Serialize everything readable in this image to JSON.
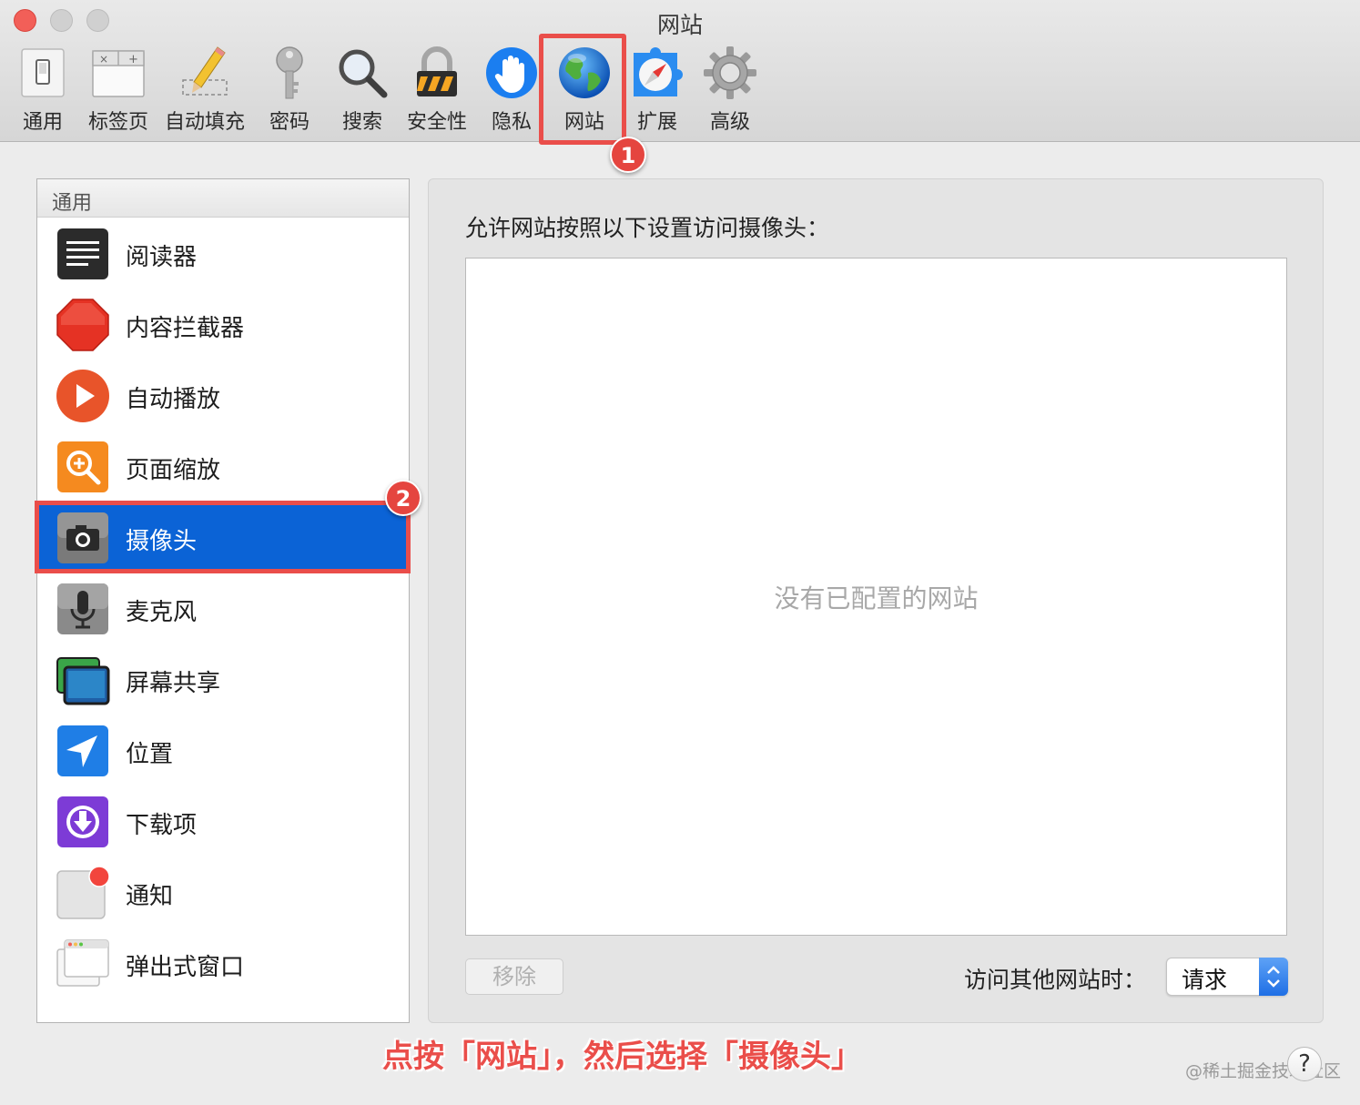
{
  "window": {
    "title": "网站"
  },
  "toolbar": {
    "tabs": [
      {
        "label": "通用",
        "icon": "general-switch-icon"
      },
      {
        "label": "标签页",
        "icon": "tabs-icon"
      },
      {
        "label": "自动填充",
        "icon": "autofill-pencil-icon"
      },
      {
        "label": "密码",
        "icon": "key-icon"
      },
      {
        "label": "搜索",
        "icon": "magnifier-icon"
      },
      {
        "label": "安全性",
        "icon": "lock-icon"
      },
      {
        "label": "隐私",
        "icon": "hand-icon"
      },
      {
        "label": "网站",
        "icon": "globe-icon",
        "selected": true
      },
      {
        "label": "扩展",
        "icon": "puzzle-compass-icon"
      },
      {
        "label": "高级",
        "icon": "gear-icon"
      }
    ]
  },
  "annotations": {
    "step1": "1",
    "step2": "2",
    "accent": "#ea4e4a"
  },
  "sidebar": {
    "header": "通用",
    "items": [
      {
        "label": "阅读器",
        "icon": "reader-icon"
      },
      {
        "label": "内容拦截器",
        "icon": "stop-sign-icon"
      },
      {
        "label": "自动播放",
        "icon": "play-icon"
      },
      {
        "label": "页面缩放",
        "icon": "zoom-icon"
      },
      {
        "label": "摄像头",
        "icon": "camera-icon",
        "selected": true
      },
      {
        "label": "麦克风",
        "icon": "microphone-icon"
      },
      {
        "label": "屏幕共享",
        "icon": "screen-share-icon"
      },
      {
        "label": "位置",
        "icon": "location-icon"
      },
      {
        "label": "下载项",
        "icon": "download-icon"
      },
      {
        "label": "通知",
        "icon": "notification-icon"
      },
      {
        "label": "弹出式窗口",
        "icon": "popup-window-icon"
      }
    ]
  },
  "main": {
    "title": "允许网站按照以下设置访问摄像头：",
    "empty_message": "没有已配置的网站",
    "remove_label": "移除",
    "other_sites_label": "访问其他网站时：",
    "other_sites_value": "请求"
  },
  "footer": {
    "caption": "点按「网站」，然后选择「摄像头」",
    "help_label": "?",
    "watermark": "@稀土掘金技术社区"
  },
  "colors": {
    "selection": "#0b63d6",
    "annotation": "#ea4e4a"
  }
}
